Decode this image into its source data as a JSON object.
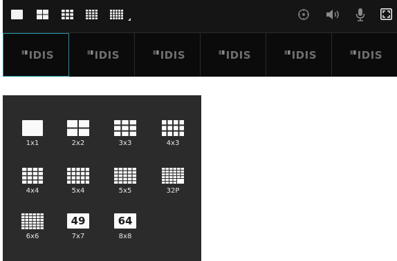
{
  "toolbar": {
    "left_buttons": [
      "single-layout-icon",
      "2x2-layout-icon",
      "3x3-layout-icon",
      "4x4-layout-icon",
      "grid-menu-icon"
    ],
    "right_buttons": [
      "ptz-icon",
      "speaker-icon",
      "microphone-icon",
      "fullscreen-icon"
    ]
  },
  "tiles": [
    {
      "logo": "IDIS",
      "active": true
    },
    {
      "logo": "IDIS",
      "active": false
    },
    {
      "logo": "IDIS",
      "active": false
    },
    {
      "logo": "IDIS",
      "active": false
    },
    {
      "logo": "IDIS",
      "active": false
    },
    {
      "logo": "IDIS",
      "active": false
    }
  ],
  "panel": {
    "options": [
      {
        "label": "1x1"
      },
      {
        "label": "2x2"
      },
      {
        "label": "3x3"
      },
      {
        "label": "4x3"
      },
      {
        "label": "4x4"
      },
      {
        "label": "5x4"
      },
      {
        "label": "5x5"
      },
      {
        "label": "32P"
      },
      {
        "label": "6x6"
      },
      {
        "label": "7x7",
        "number": "49"
      },
      {
        "label": "8x8",
        "number": "64"
      }
    ]
  }
}
